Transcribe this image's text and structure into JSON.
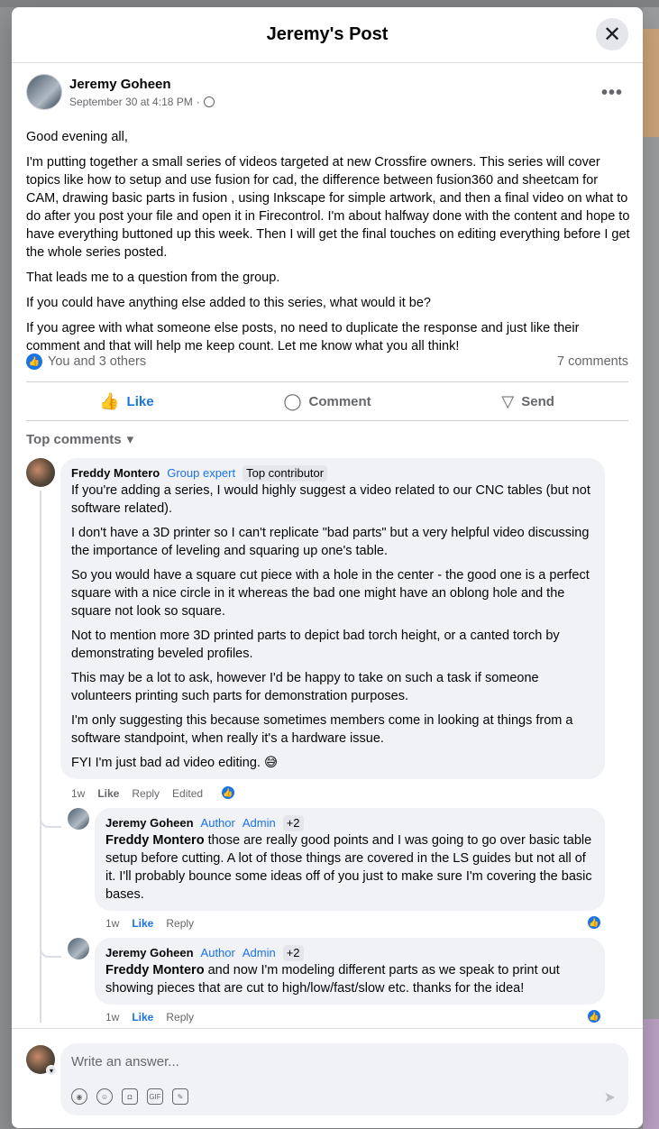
{
  "header": {
    "title": "Jeremy's Post",
    "close_glyph": "✕"
  },
  "post": {
    "author": "Jeremy Goheen",
    "time": "September 30 at 4:18 PM",
    "separator": "·",
    "more_glyph": "•••",
    "paragraphs": [
      "Good evening all,",
      "I'm putting together a small series of videos targeted at new Crossfire owners. This series will cover topics like how to setup and use fusion for cad, the difference between fusion360 and sheetcam for CAM, drawing basic parts in fusion , using Inkscape for simple artwork, and then a final video on what to do after you post your file and open it in Firecontrol. I'm about halfway done with the content and hope to have everything buttoned up this week. Then I will get the final touches on editing everything before I get the whole series posted.",
      "That leads me to a question from the group.",
      "If you could have anything else added to this series, what would it be?",
      "If you agree with what someone else posts, no need to duplicate the response and just like their comment and that will help me keep count. Let me know what you all think!"
    ],
    "reactions_text": "You and 3 others",
    "comments_count": "7 comments"
  },
  "actions": {
    "like": "Like",
    "comment": "Comment",
    "send": "Send"
  },
  "sort_label": "Top comments",
  "comments": [
    {
      "name": "Freddy Montero",
      "badge1": "Group expert",
      "badge2": "Top contributor",
      "paragraphs": [
        "If you're adding a series, I would highly suggest a video related to our CNC tables (but not software related).",
        "I don't have a 3D printer so I can't replicate \"bad parts\" but a very helpful video discussing the importance of leveling and squaring up one's table.",
        "So you would have a square cut piece with a hole in the center - the good one is a perfect square with a nice circle in it whereas the bad one might have an oblong hole and the square not look so square.",
        "Not to mention more 3D printed parts to depict bad torch height, or a canted torch by demonstrating beveled profiles.",
        "This may be a lot to ask, however I'd be happy to take on such a task if someone volunteers printing such parts for demonstration purposes.",
        "I'm only suggesting this because sometimes members come in looking at things from a software standpoint, when really it's a hardware issue.",
        "FYI I'm just bad ad video editing. 😅"
      ],
      "time": "1w",
      "like": "Like",
      "reply": "Reply",
      "edited": "Edited"
    },
    {
      "name": "Jeremy Goheen",
      "badge1": "Author",
      "badge2": "Admin",
      "badge3": "+2",
      "mention": "Freddy Montero",
      "text": " those are really good points and I was going to go over basic table setup before cutting. A lot of those things are covered in the LS guides but not all of it. I'll probably bounce some ideas off of you just to make sure I'm covering the basic bases.",
      "time": "1w",
      "like": "Like",
      "reply": "Reply"
    },
    {
      "name": "Jeremy Goheen",
      "badge1": "Author",
      "badge2": "Admin",
      "badge3": "+2",
      "mention": "Freddy Montero",
      "text": " and now I'm modeling different parts as we speak to print out showing pieces that are cut to high/low/fast/slow etc. thanks for the idea!",
      "time": "1w",
      "like": "Like",
      "reply": "Reply"
    }
  ],
  "composer": {
    "placeholder": "Write an answer...",
    "send_glyph": "➤"
  },
  "colors": {
    "accent": "#1b74e4",
    "bubble": "#f0f2f5",
    "muted": "#65676b"
  }
}
